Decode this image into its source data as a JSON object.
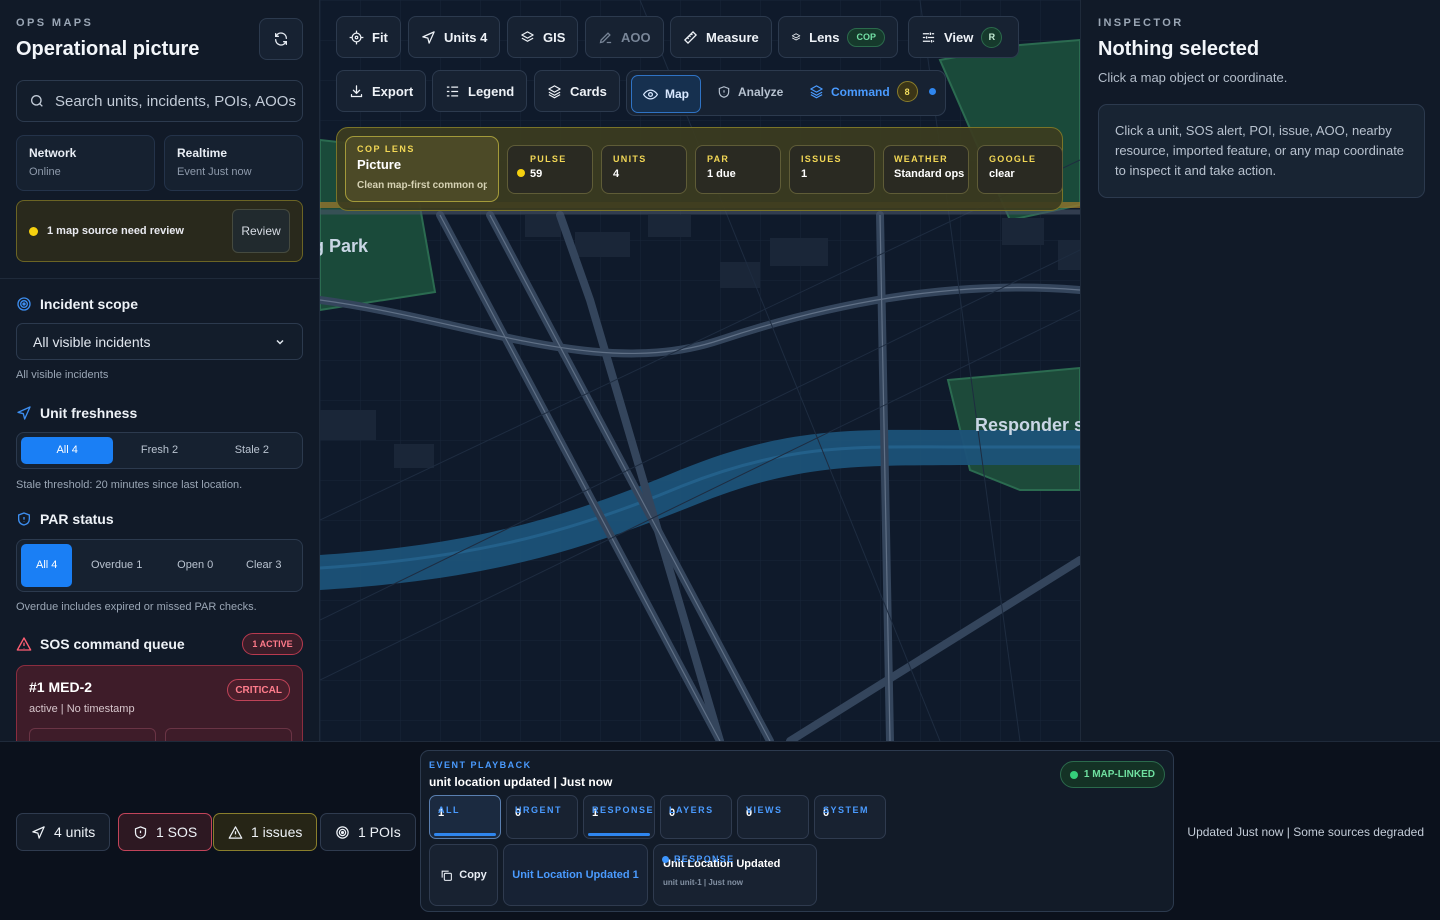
{
  "left": {
    "eyebrow": "OPS MAPS",
    "title": "Operational picture",
    "search_placeholder": "Search units, incidents, POIs, AOOs",
    "network": {
      "label": "Network",
      "value": "Online"
    },
    "realtime": {
      "label": "Realtime",
      "value": "Event Just now"
    },
    "alert": {
      "text": "1 map source need review",
      "button": "Review"
    },
    "incident_scope": {
      "title": "Incident scope",
      "selected": "All visible incidents",
      "note": "All visible incidents"
    },
    "unit_freshness": {
      "title": "Unit freshness",
      "options": [
        "All 4",
        "Fresh 2",
        "Stale 2"
      ],
      "note": "Stale threshold: 20 minutes since last location."
    },
    "par_status": {
      "title": "PAR status",
      "options": [
        "All 4",
        "Overdue 1",
        "Open 0",
        "Clear 3"
      ],
      "note": "Overdue includes expired or missed PAR checks."
    },
    "sos_queue": {
      "title": "SOS command queue",
      "badge": "1 ACTIVE",
      "card": {
        "title": "#1 MED-2",
        "severity": "CRITICAL",
        "meta": "active | No timestamp"
      }
    }
  },
  "toolbar": {
    "row1": [
      {
        "label": "Fit",
        "icon": "crosshair-icon"
      },
      {
        "label": "Units 4",
        "icon": "navigation-icon"
      },
      {
        "label": "GIS",
        "icon": "layers-icon"
      },
      {
        "label": "AOO",
        "icon": "pencil-icon"
      },
      {
        "label": "Measure",
        "icon": "ruler-icon"
      },
      {
        "label": "Lens",
        "icon": "layers-icon",
        "pill": "COP"
      },
      {
        "label": "View",
        "icon": "sliders-icon",
        "pill": "R"
      }
    ],
    "row2": [
      {
        "label": "Export",
        "icon": "download-icon"
      },
      {
        "label": "Legend",
        "icon": "list-icon"
      },
      {
        "label": "Cards",
        "icon": "layers-icon"
      }
    ],
    "modes": {
      "map": "Map",
      "analyze": "Analyze",
      "command": "Command",
      "command_count": "8"
    }
  },
  "lens": {
    "main": {
      "key": "COP LENS",
      "value": "Picture",
      "desc": "Clean map-first common operating picture"
    },
    "chips": [
      {
        "key": "PULSE",
        "value": "59"
      },
      {
        "key": "UNITS",
        "value": "4"
      },
      {
        "key": "PAR",
        "value": "1 due"
      },
      {
        "key": "ISSUES",
        "value": "1"
      },
      {
        "key": "WEATHER",
        "value": "Standard ops"
      },
      {
        "key": "GOOGLE",
        "value": "clear"
      }
    ]
  },
  "map_labels": {
    "park": "Ming Park",
    "responder": "Responder staging"
  },
  "inspector": {
    "eyebrow": "INSPECTOR",
    "title": "Nothing selected",
    "subtitle": "Click a map object or coordinate.",
    "hint": "Click a unit, SOS alert, POI, issue, AOO, nearby resource, imported feature, or any map coordinate to inspect it and take action."
  },
  "bottom": {
    "chips": [
      {
        "label": "4 units",
        "icon": "navigation-icon"
      },
      {
        "label": "1 SOS",
        "icon": "shield-icon"
      },
      {
        "label": "1 issues",
        "icon": "warning-icon"
      },
      {
        "label": "1 POIs",
        "icon": "target-icon"
      }
    ],
    "playback": {
      "key": "EVENT PLAYBACK",
      "title": "unit location updated | Just now",
      "linked": "1 MAP-LINKED",
      "filters": [
        {
          "key": "ALL",
          "value": "1"
        },
        {
          "key": "URGENT",
          "value": "0"
        },
        {
          "key": "RESPONSE",
          "value": "1"
        },
        {
          "key": "LAYERS",
          "value": "0"
        },
        {
          "key": "VIEWS",
          "value": "0"
        },
        {
          "key": "SYSTEM",
          "value": "0"
        }
      ],
      "copy": "Copy",
      "event_link": "Unit Location Updated 1",
      "event": {
        "category": "RESPONSE",
        "title": "Unit Location Updated",
        "meta": "unit unit-1 | Just now"
      }
    },
    "updated": "Updated Just now | Some sources degraded"
  },
  "colors": {
    "accent": "#1a7ff5",
    "warning": "#f5d10f",
    "danger": "#c2445a",
    "success": "#35d07a"
  }
}
